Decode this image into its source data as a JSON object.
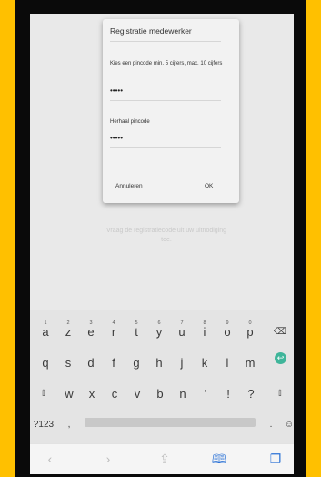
{
  "dialog": {
    "title": "Registratie medewerker",
    "pin_label": "Kies een pincode min. 5 cijfers, max. 10 cijfers",
    "pin_value": "•••••",
    "repeat_label": "Herhaal pincode",
    "repeat_value": "•••••",
    "cancel": "Annuleren",
    "ok": "OK"
  },
  "background": {
    "hint": "Vraag de registratiecode uit uw uitnodiging toe."
  },
  "keyboard": {
    "row1": [
      {
        "key": "a",
        "num": "1"
      },
      {
        "key": "z",
        "num": "2"
      },
      {
        "key": "e",
        "num": "3"
      },
      {
        "key": "r",
        "num": "4"
      },
      {
        "key": "t",
        "num": "5"
      },
      {
        "key": "y",
        "num": "6"
      },
      {
        "key": "u",
        "num": "7"
      },
      {
        "key": "i",
        "num": "8"
      },
      {
        "key": "o",
        "num": "9"
      },
      {
        "key": "p",
        "num": "0"
      }
    ],
    "row2": [
      "q",
      "s",
      "d",
      "f",
      "g",
      "h",
      "j",
      "k",
      "l",
      "m"
    ],
    "row3": [
      "w",
      "x",
      "c",
      "v",
      "b",
      "n",
      "'",
      "!",
      "?"
    ],
    "shift": "⇧",
    "backspace": "⌫",
    "enter": "↩",
    "sym": "?123",
    "comma": ",",
    "period": ".",
    "emoji": "☺"
  },
  "nav": {
    "back": "‹",
    "forward": "›",
    "share": "⇪",
    "bookmarks": "🕮",
    "tabs": "❐"
  }
}
